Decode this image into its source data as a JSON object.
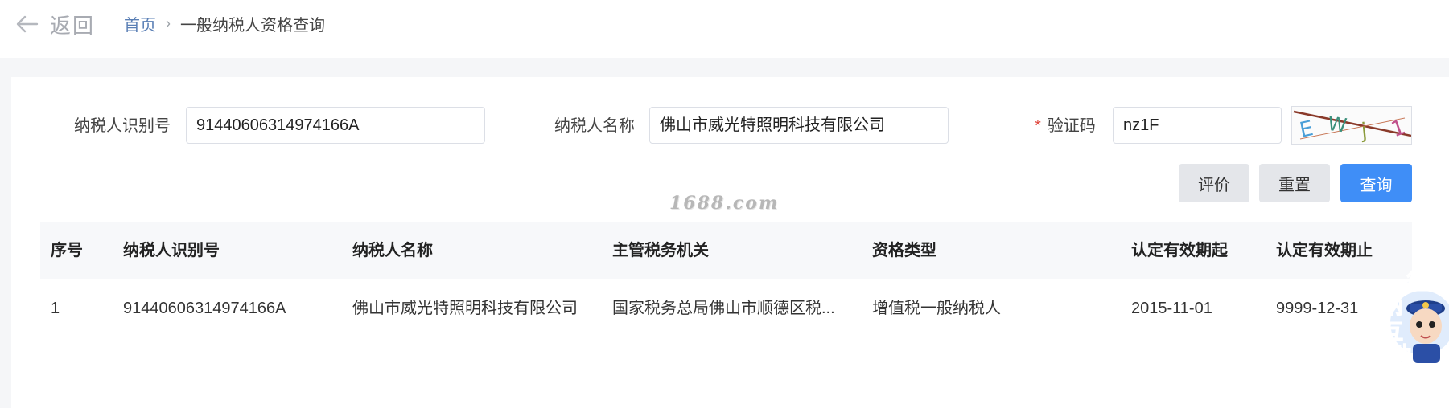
{
  "header": {
    "back_label": "返回",
    "breadcrumb_home": "首页",
    "breadcrumb_current": "一般纳税人资格查询"
  },
  "form": {
    "taxpayer_id_label": "纳税人识别号",
    "taxpayer_id_value": "91440606314974166A",
    "taxpayer_name_label": "纳税人名称",
    "taxpayer_name_value": "佛山市威光特照明科技有限公司",
    "captcha_required_mark": "*",
    "captcha_label": "验证码",
    "captcha_value": "nz1F",
    "captcha_image_text": "EWj1"
  },
  "buttons": {
    "evaluate": "评价",
    "reset": "重置",
    "query": "查询"
  },
  "watermark": "1688.com",
  "table": {
    "columns": [
      "序号",
      "纳税人识别号",
      "纳税人名称",
      "主管税务机关",
      "资格类型",
      "认定有效期起",
      "认定有效期止"
    ],
    "rows": [
      [
        "1",
        "91440606314974166A",
        "佛山市威光特照明科技有限公司",
        "国家税务总局佛山市顺德区税...",
        "增值税一般纳税人",
        "2015-11-01",
        "9999-12-31"
      ]
    ]
  },
  "mascot": {
    "text": "征纳互动"
  },
  "colors": {
    "primary": "#3f8ef7",
    "link": "#5a7fb5",
    "required": "#e0483e",
    "page_bg": "#f5f6f8"
  }
}
